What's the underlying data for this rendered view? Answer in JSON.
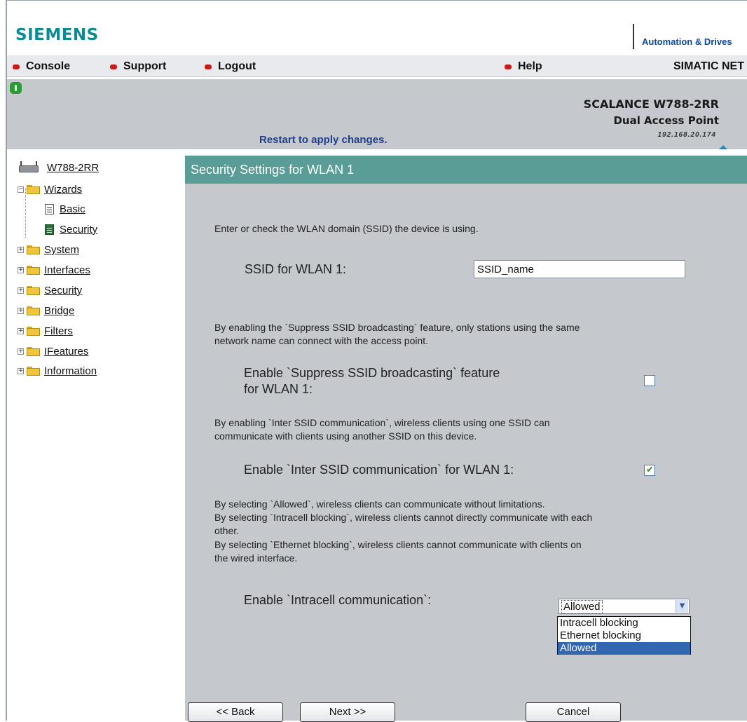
{
  "brand": {
    "logo": "SIEMENS",
    "tagline": "Automation & Drives"
  },
  "nav": {
    "items": [
      "Console",
      "Support",
      "Logout"
    ],
    "help": "Help",
    "product_line": "SIMATIC NET"
  },
  "device": {
    "model": "SCALANCE W788-2RR",
    "type": "Dual Access Point",
    "ip": "192.168.20.174",
    "restart_notice": "Restart to apply changes."
  },
  "sidebar": {
    "root": "W788-2RR",
    "wizards": {
      "label": "Wizards",
      "children": [
        "Basic",
        "Security"
      ]
    },
    "folders": [
      "System",
      "Interfaces",
      "Security",
      "Bridge",
      "Filters",
      "IFeatures",
      "Information"
    ]
  },
  "main": {
    "title": "Security Settings for WLAN 1",
    "ssid_intro": "Enter or check the WLAN domain (SSID) the device is using.",
    "ssid_label": "SSID for WLAN 1:",
    "ssid_value": "SSID_name",
    "suppress_desc_1": "By enabling the `Suppress SSID broadcasting` feature, only stations using the same",
    "suppress_desc_2": "network name can connect with the access point.",
    "suppress_label_1": "Enable `Suppress SSID broadcasting` feature",
    "suppress_label_2": "for WLAN 1:",
    "suppress_checked": false,
    "inter_desc_1": "By enabling `Inter SSID communication`, wireless clients using one SSID can",
    "inter_desc_2": "communicate with clients using another SSID on this device.",
    "inter_label": "Enable `Inter SSID communication` for WLAN 1:",
    "inter_checked": true,
    "intracell_desc_1": "By selecting `Allowed`, wireless clients can communicate without limitations.",
    "intracell_desc_2": "By selecting `Intracell blocking`, wireless clients cannot directly communicate with each",
    "intracell_desc_3": "other.",
    "intracell_desc_4": "By selecting `Ethernet blocking`, wireless clients cannot communicate with clients on",
    "intracell_desc_5": "the wired interface.",
    "intracell_label": "Enable `Intracell communication`:",
    "intracell_value": "Allowed",
    "intracell_options": [
      "Intracell blocking",
      "Ethernet blocking",
      "Allowed"
    ],
    "buttons": {
      "back": "<< Back",
      "next": "Next >>",
      "cancel": "Cancel"
    }
  },
  "colors": {
    "logo": "#0a8c96",
    "section_header": "#5a9c96",
    "page_bg": "#c5c8cc",
    "selected_option": "#3166b0",
    "nav_bullet": "#cc1a1a"
  }
}
